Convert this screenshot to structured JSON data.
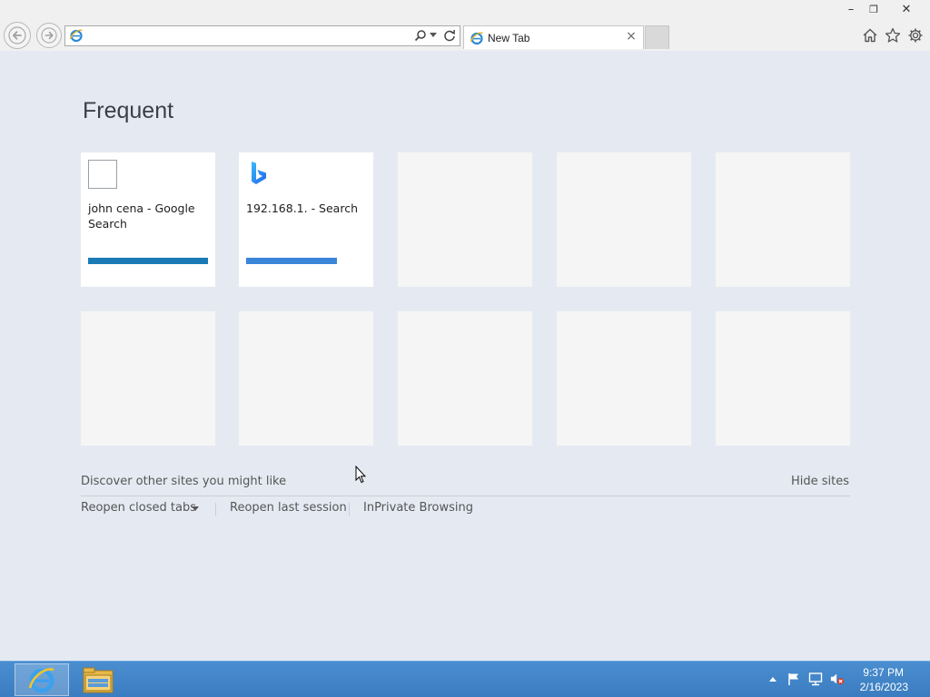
{
  "window": {
    "minimize_glyph": "–",
    "restore_glyph": "❐",
    "close_glyph": "✕"
  },
  "toolbar": {
    "back_icon": "back-arrow-icon",
    "forward_icon": "forward-arrow-icon",
    "address_value": "",
    "address_favicon": "ie-icon",
    "search_icon": "magnifier-icon",
    "dropdown_icon": "chevron-down-icon",
    "refresh_icon": "refresh-icon",
    "home_icon": "home-icon",
    "favorites_icon": "star-icon",
    "tools_icon": "gear-icon"
  },
  "tab": {
    "title": "New Tab",
    "close_glyph": "×"
  },
  "page": {
    "heading": "Frequent",
    "tiles": [
      {
        "label": "john cena - Google Search",
        "favicon": "blank",
        "bar_color": "#1a7ab8",
        "filled": true
      },
      {
        "label": "192.168.1. - Search",
        "favicon": "bing-icon",
        "bar_color": "#3b86d9",
        "filled": true
      },
      {
        "label": "",
        "filled": false
      },
      {
        "label": "",
        "filled": false
      },
      {
        "label": "",
        "filled": false
      },
      {
        "label": "",
        "filled": false
      },
      {
        "label": "",
        "filled": false
      },
      {
        "label": "",
        "filled": false
      },
      {
        "label": "",
        "filled": false
      },
      {
        "label": "",
        "filled": false
      }
    ],
    "discover_text": "Discover other sites you might like",
    "hide_sites": "Hide sites",
    "reopen_closed_tabs": "Reopen closed tabs",
    "reopen_last_session": "Reopen last session",
    "inprivate": "InPrivate Browsing"
  },
  "taskbar": {
    "pinned": [
      "ie-icon",
      "file-explorer-icon"
    ],
    "tray_icons": [
      "show-hidden-icons-icon",
      "action-center-flag-icon",
      "network-icon",
      "volume-muted-icon"
    ],
    "time": "9:37 PM",
    "date": "2/16/2023"
  },
  "colors": {
    "background": "#e5eaf2",
    "taskbar": "#3b7cc0",
    "tile_empty": "#f5f5f5"
  }
}
